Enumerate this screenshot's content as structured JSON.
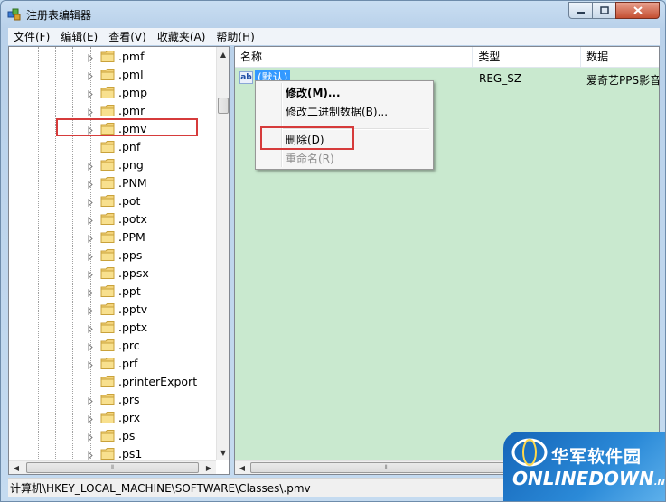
{
  "window": {
    "title": "注册表编辑器"
  },
  "menubar": [
    "文件(F)",
    "编辑(E)",
    "查看(V)",
    "收藏夹(A)",
    "帮助(H)"
  ],
  "tree": {
    "items": [
      ".pmf",
      ".pml",
      ".pmp",
      ".pmr",
      ".pmv",
      ".pnf",
      ".png",
      ".PNM",
      ".pot",
      ".potx",
      ".PPM",
      ".pps",
      ".ppsx",
      ".ppt",
      ".pptv",
      ".pptx",
      ".prc",
      ".prf",
      ".printerExport",
      ".prs",
      ".prx",
      ".ps",
      ".ps1"
    ],
    "has_expander": [
      true,
      true,
      true,
      true,
      true,
      false,
      true,
      true,
      true,
      true,
      true,
      true,
      true,
      true,
      true,
      true,
      true,
      true,
      false,
      true,
      true,
      true,
      true
    ],
    "highlighted": ".pmv"
  },
  "list": {
    "columns": [
      "名称",
      "类型",
      "数据"
    ],
    "rows": [
      {
        "name": "(默认)",
        "type": "REG_SZ",
        "data": "爱奇艺PPS影音"
      }
    ]
  },
  "context_menu": {
    "items": [
      {
        "label": "修改(M)...",
        "bold": true,
        "disabled": false
      },
      {
        "label": "修改二进制数据(B)...",
        "bold": false,
        "disabled": false
      },
      {
        "label": "删除(D)",
        "bold": false,
        "disabled": false
      },
      {
        "label": "重命名(R)",
        "bold": false,
        "disabled": true
      }
    ],
    "highlighted": "删除(D)"
  },
  "statusbar": {
    "path": "计算机\\HKEY_LOCAL_MACHINE\\SOFTWARE\\Classes\\.pmv"
  },
  "watermark": {
    "cn": "华军软件园",
    "en": "ONLINEDOWN",
    "suffix": ".NET"
  },
  "colors": {
    "highlight_box": "#d63b3b",
    "list_bg": "#c9e9cf",
    "selection": "#3399ff"
  }
}
